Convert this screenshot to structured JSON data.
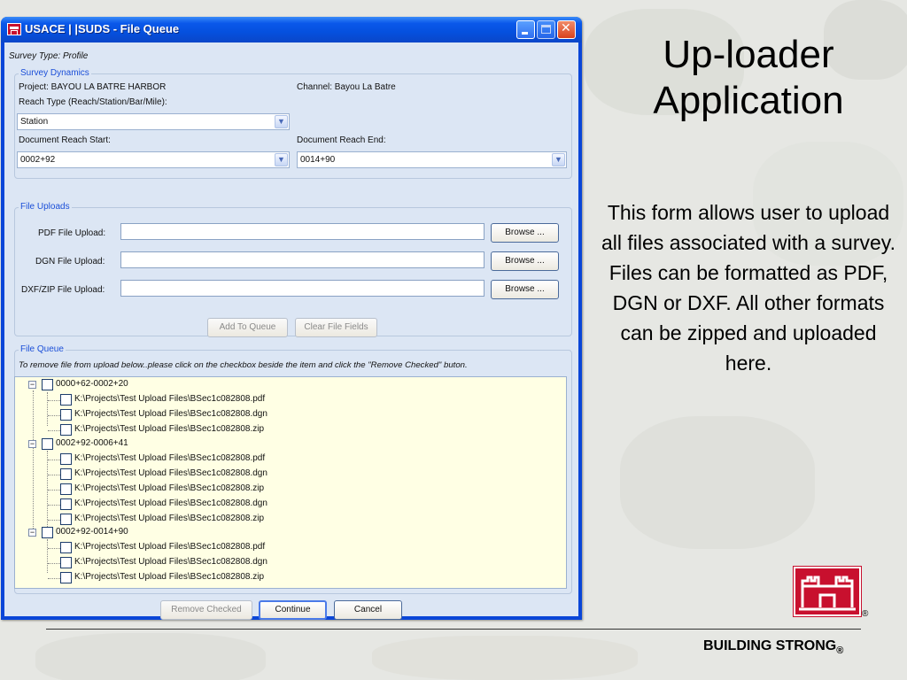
{
  "window": {
    "title": "USACE | |SUDS - File Queue",
    "survey_type": "Survey Type: Profile"
  },
  "survey_dynamics": {
    "legend": "Survey Dynamics",
    "project": "Project: BAYOU LA BATRE HARBOR",
    "channel": "Channel: Bayou La Batre",
    "reach_type_label": "Reach Type (Reach/Station/Bar/Mile):",
    "reach_type_value": "Station",
    "reach_start_label": "Document Reach Start:",
    "reach_start_value": "0002+92",
    "reach_end_label": "Document Reach End:",
    "reach_end_value": "0014+90"
  },
  "file_uploads": {
    "legend": "File Uploads",
    "rows": [
      {
        "label": "PDF File Upload:",
        "value": "",
        "browse": "Browse ..."
      },
      {
        "label": "DGN File Upload:",
        "value": "",
        "browse": "Browse ..."
      },
      {
        "label": "DXF/ZIP File Upload:",
        "value": "",
        "browse": "Browse ..."
      }
    ],
    "add_to_queue": "Add To Queue",
    "clear_fields": "Clear File Fields"
  },
  "file_queue": {
    "legend": "File Queue",
    "instructions": "To remove file from upload below..please click on the checkbox beside the item and click the \"Remove Checked\" buton.",
    "groups": [
      {
        "label": "0000+62-0002+20",
        "files": [
          "K:\\Projects\\Test Upload Files\\BSec1c082808.pdf",
          "K:\\Projects\\Test Upload Files\\BSec1c082808.dgn",
          "K:\\Projects\\Test Upload Files\\BSec1c082808.zip"
        ]
      },
      {
        "label": "0002+92-0006+41",
        "files": [
          "K:\\Projects\\Test Upload Files\\BSec1c082808.pdf",
          "K:\\Projects\\Test Upload Files\\BSec1c082808.dgn",
          "K:\\Projects\\Test Upload Files\\BSec1c082808.zip",
          "K:\\Projects\\Test Upload Files\\BSec1c082808.dgn",
          "K:\\Projects\\Test Upload Files\\BSec1c082808.zip"
        ]
      },
      {
        "label": "0002+92-0014+90",
        "files": [
          "K:\\Projects\\Test Upload Files\\BSec1c082808.pdf",
          "K:\\Projects\\Test Upload Files\\BSec1c082808.dgn",
          "K:\\Projects\\Test Upload Files\\BSec1c082808.zip"
        ]
      }
    ]
  },
  "buttons": {
    "remove_checked": "Remove Checked",
    "continue": "Continue",
    "cancel": "Cancel"
  },
  "slide": {
    "title": "Up-loader Application",
    "body": "This form allows user to upload all files associated with a survey. Files can be formatted as PDF, DGN or DXF. All other formats can be zipped and uploaded here.",
    "footer": "BUILDING STRONG",
    "footer_mark": "®",
    "logo_mark": "®"
  },
  "colors": {
    "titlebar": "#0550de",
    "client_bg": "#dce6f4",
    "legend_text": "#1b4fd8",
    "tree_bg": "#ffffe4",
    "logo_red": "#c8102e"
  }
}
